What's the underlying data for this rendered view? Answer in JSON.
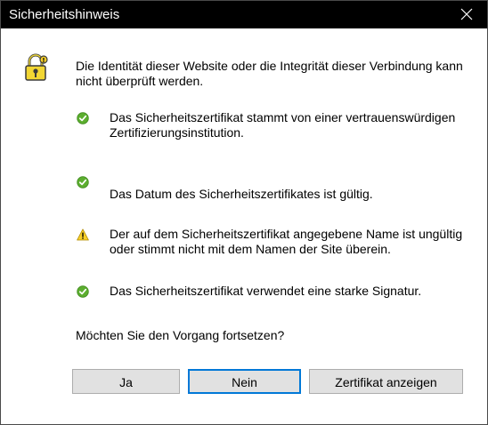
{
  "window": {
    "title": "Sicherheitshinweis",
    "close_symbol": "×"
  },
  "intro_text": "Die Identität dieser Website oder die Integrität dieser Verbindung kann nicht überprüft werden.",
  "items": [
    {
      "status": "ok",
      "icon": "check-circle-icon",
      "text": "Das Sicherheitszertifikat stammt von einer vertrauenswürdigen Zertifizierungsinstitution."
    },
    {
      "status": "ok",
      "icon": "check-circle-icon",
      "text": "Das Datum des Sicherheitszertifikates ist gültig."
    },
    {
      "status": "warning",
      "icon": "warning-triangle-icon",
      "text": "Der auf dem Sicherheitszertifikat angegebene Name ist ungültig oder stimmt nicht mit dem Namen der Site überein."
    },
    {
      "status": "ok",
      "icon": "check-circle-icon",
      "text": "Das Sicherheitszertifikat verwendet eine starke Signatur."
    }
  ],
  "question": "Möchten Sie den Vorgang fortsetzen?",
  "buttons": {
    "yes": "Ja",
    "no": "Nein",
    "view_certificate": "Zertifikat anzeigen"
  },
  "colors": {
    "titlebar": "#000000",
    "ok_green": "#5cae2f",
    "warning_yellow": "#f7cf2a",
    "button_bg": "#e1e1e1",
    "button_border": "#adadad",
    "default_button_border": "#0078d7"
  }
}
